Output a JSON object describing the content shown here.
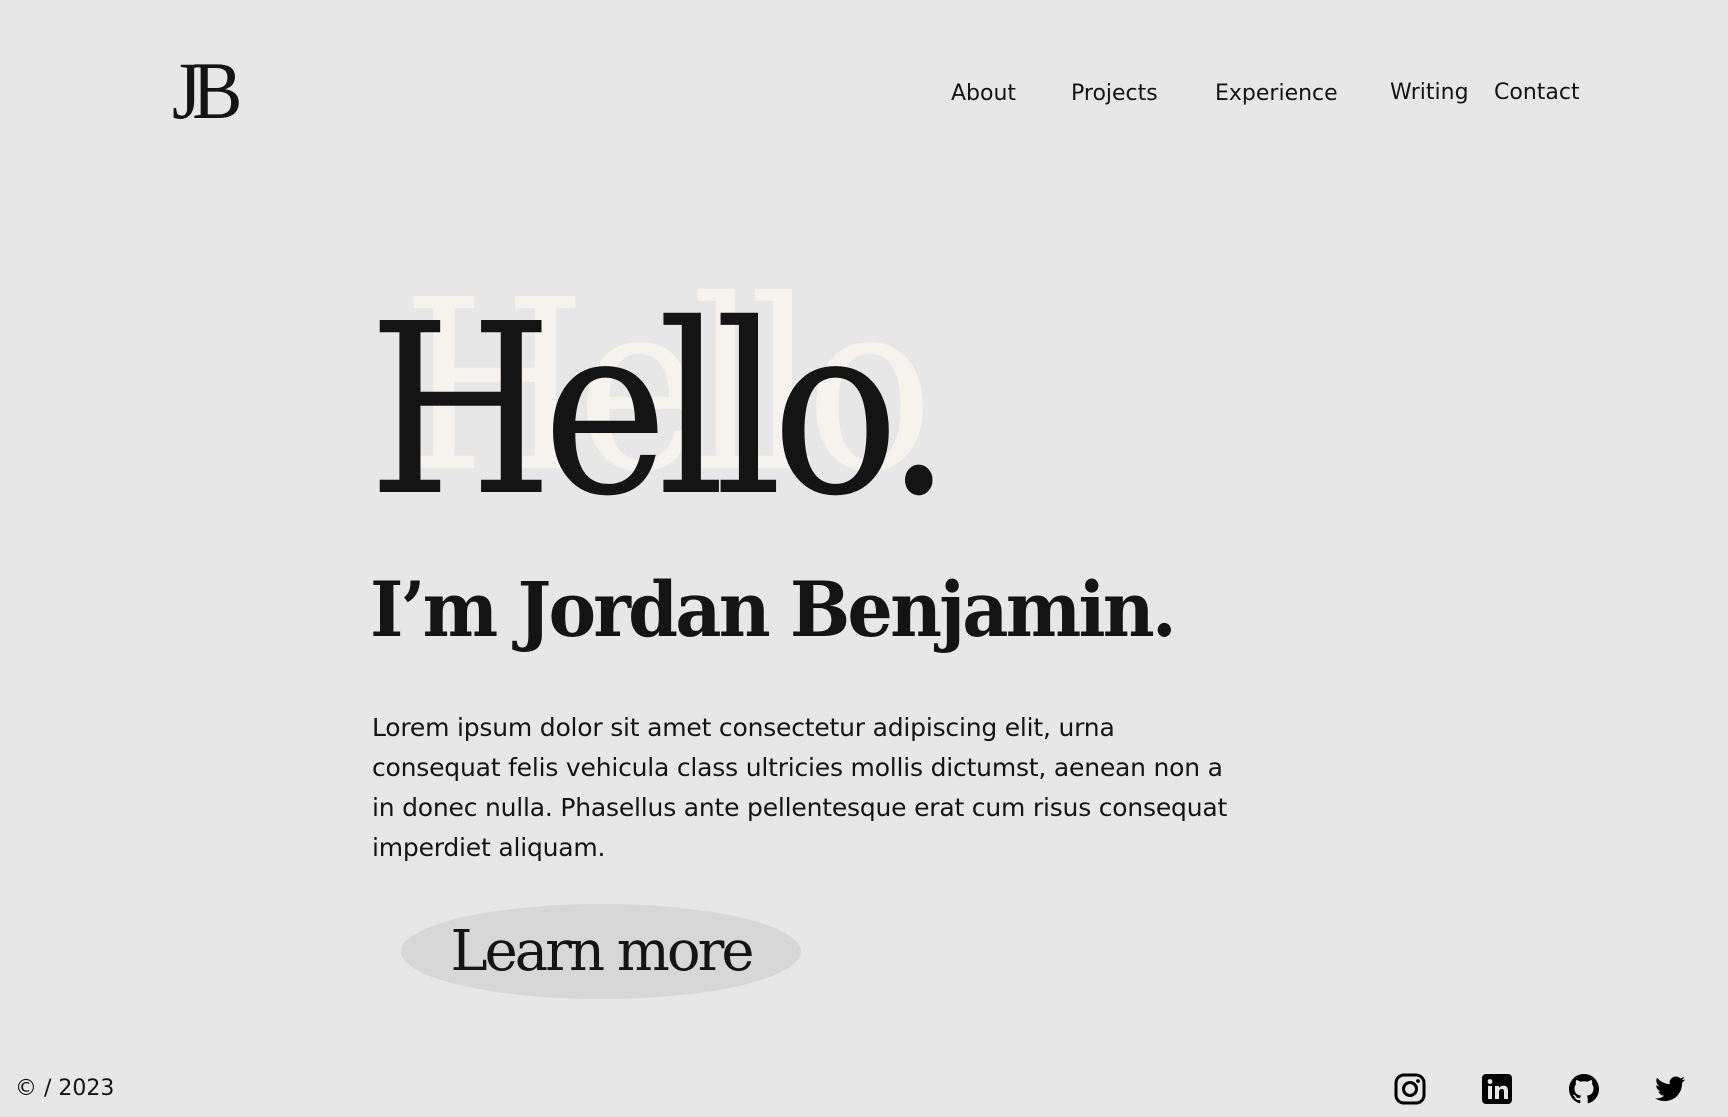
{
  "header": {
    "logo": "JB",
    "nav": {
      "about": "About",
      "projects": "Projects",
      "experience": "Experience",
      "writing": "Writing",
      "contact": "Contact"
    }
  },
  "hero": {
    "greeting": "Hello.",
    "greeting_shadow": "Hello",
    "intro": "I’m Jordan Benjamin.",
    "description": "Lorem ipsum dolor sit amet consectetur adipiscing elit, urna consequat felis vehicula class ultricies mollis dictumst, aenean non a in donec nulla. Phasellus ante pellentesque erat cum risus consequat imperdiet aliquam.",
    "cta_label": "Learn more"
  },
  "footer": {
    "copyright": "© / 2023",
    "social_icons": [
      "instagram-icon",
      "linkedin-icon",
      "github-icon",
      "twitter-icon"
    ]
  },
  "colors": {
    "background": "#e7e7e7",
    "text": "#141414",
    "button": "#d7d7d7",
    "shadow_text": "#f6f2ee"
  }
}
